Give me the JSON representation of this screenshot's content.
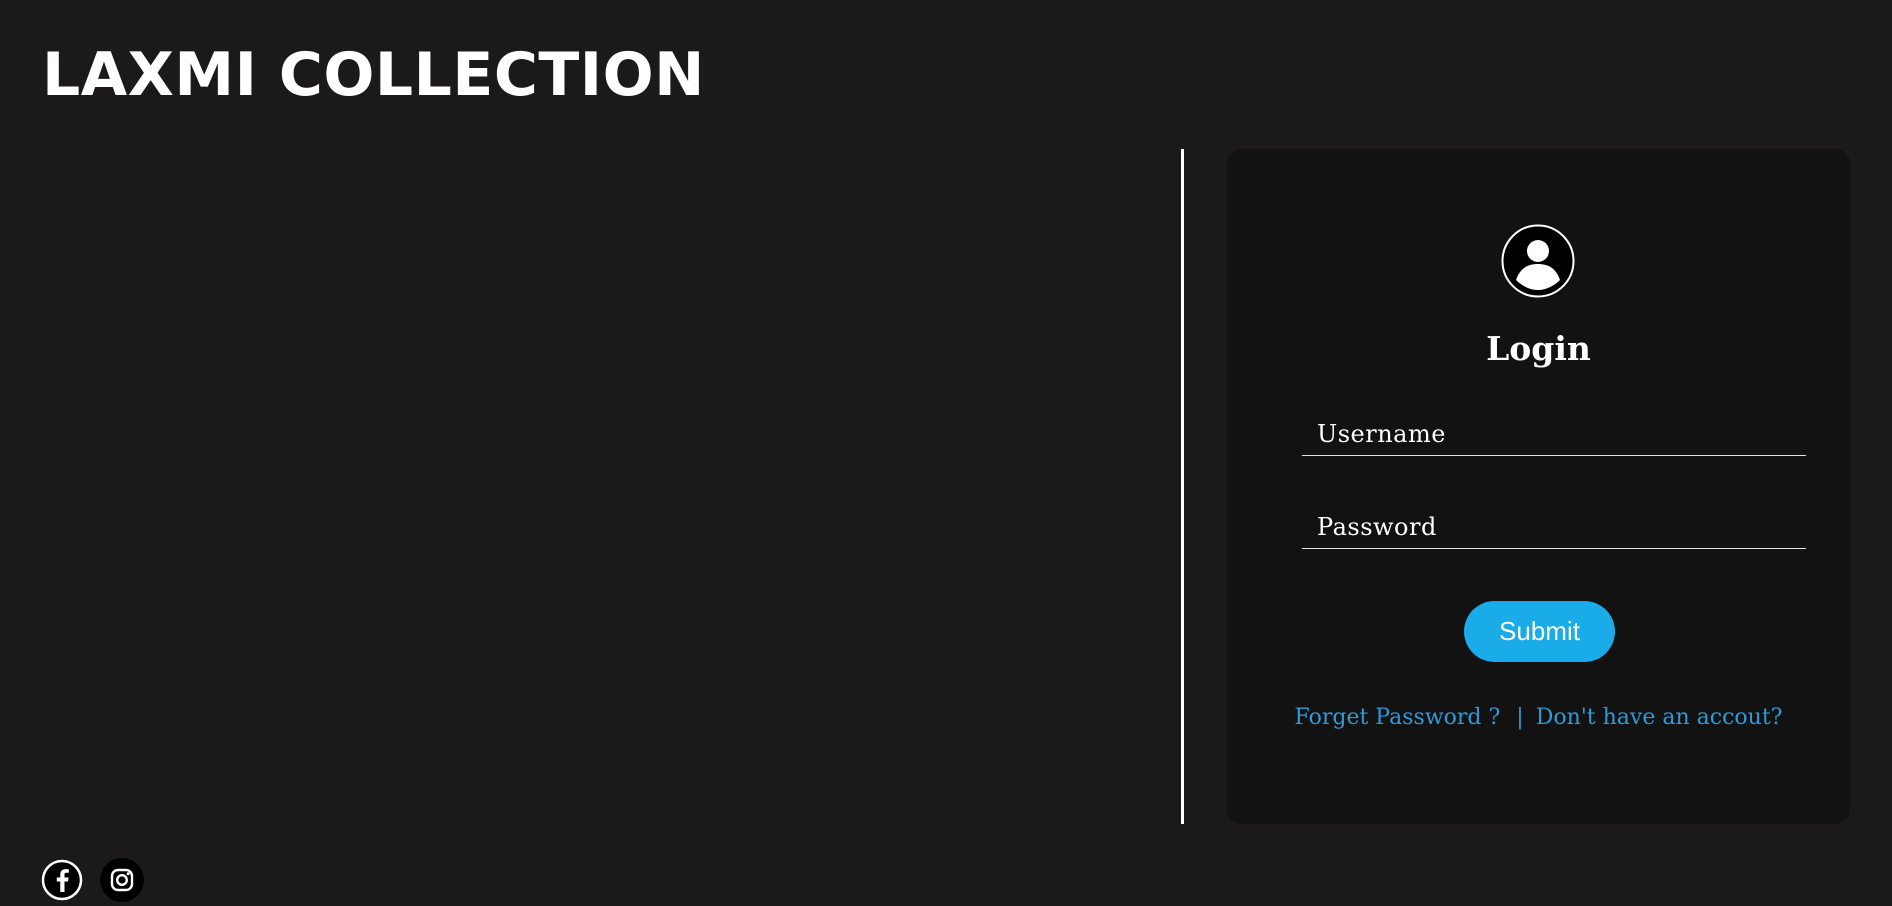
{
  "brand": {
    "title": "LAXMI COLLECTION"
  },
  "login": {
    "avatar_icon": "user-circle-icon",
    "title": "Login",
    "username_placeholder": "Username",
    "password_placeholder": "Password",
    "submit_label": "Submit",
    "forget_password_label": "Forget Password ?",
    "separator": "|",
    "signup_label": "Don't have an accout?"
  },
  "social": {
    "icons": [
      "facebook-icon",
      "instagram-icon"
    ]
  },
  "colors": {
    "background": "#1b191a",
    "card": "#121212",
    "accent": "#1aace9",
    "link": "#2d9ad9"
  }
}
